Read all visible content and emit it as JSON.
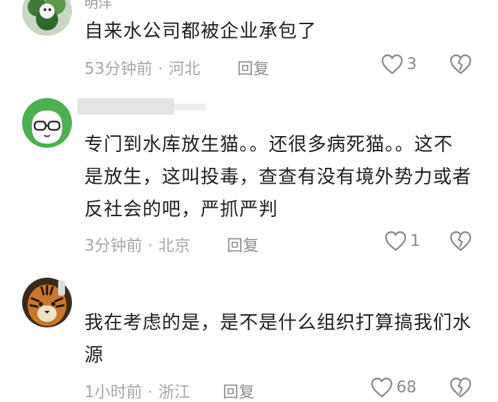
{
  "comments": [
    {
      "username": "明洋",
      "content": "自来水公司都被企业承包了",
      "time": "53分钟前",
      "location": "河北",
      "reply_label": "回复",
      "like_count": "3",
      "avatar": "green-leaf-avatar"
    },
    {
      "username": "",
      "content": "专门到水库放生猫。。还很多病死猫。。这不是放生，这叫投毒，查查有没有境外势力或者反社会的吧，严抓严判",
      "time": "3分钟前",
      "location": "北京",
      "reply_label": "回复",
      "like_count": "1",
      "avatar": "green-cat-avatar"
    },
    {
      "username": "",
      "content": "我在考虑的是，是不是什么组织打算搞我们水源",
      "time": "1小时前",
      "location": "浙江",
      "reply_label": "回复",
      "like_count": "68",
      "avatar": "tiger-avatar"
    }
  ],
  "icons": {
    "like": "heart-outline-icon",
    "dislike": "broken-heart-icon"
  },
  "colors": {
    "text": "#1f1f1f",
    "meta": "#a7a7a7",
    "icon": "#8a8a8a"
  }
}
